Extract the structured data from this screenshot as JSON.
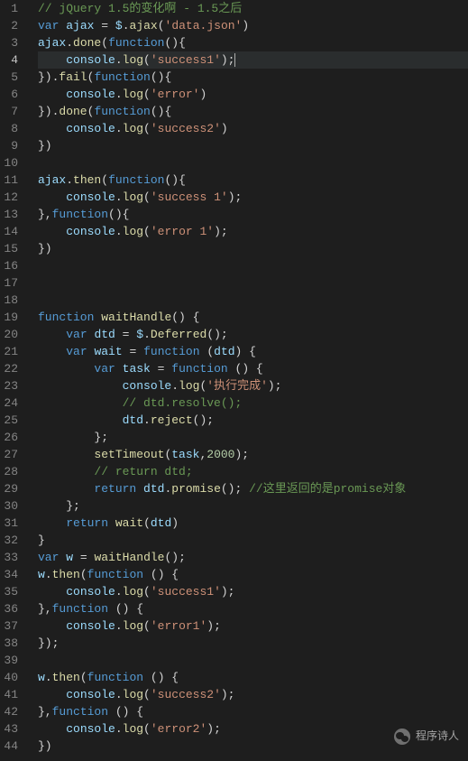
{
  "editor": {
    "activeLine": 4,
    "lines": [
      {
        "n": 1,
        "tokens": [
          [
            "c-comment",
            "// jQuery 1.5的变化啊 - 1.5之后"
          ]
        ]
      },
      {
        "n": 2,
        "tokens": [
          [
            "c-kw",
            "var"
          ],
          [
            "",
            " "
          ],
          [
            "c-var",
            "ajax"
          ],
          [
            "",
            " "
          ],
          [
            "c-punc",
            "="
          ],
          [
            "",
            " "
          ],
          [
            "c-var",
            "$"
          ],
          [
            "c-punc",
            "."
          ],
          [
            "c-func",
            "ajax"
          ],
          [
            "c-punc",
            "("
          ],
          [
            "c-str",
            "'data.json'"
          ],
          [
            "c-punc",
            ")"
          ]
        ]
      },
      {
        "n": 3,
        "tokens": [
          [
            "c-var",
            "ajax"
          ],
          [
            "c-punc",
            "."
          ],
          [
            "c-func",
            "done"
          ],
          [
            "c-punc",
            "("
          ],
          [
            "c-kw",
            "function"
          ],
          [
            "c-punc",
            "(){"
          ]
        ]
      },
      {
        "n": 4,
        "hl": true,
        "tokens": [
          [
            "",
            "    "
          ],
          [
            "c-var",
            "console"
          ],
          [
            "c-punc",
            "."
          ],
          [
            "c-func",
            "log"
          ],
          [
            "c-punc",
            "("
          ],
          [
            "c-str",
            "'success1'"
          ],
          [
            "c-punc",
            ");"
          ],
          [
            "cursor",
            ""
          ]
        ]
      },
      {
        "n": 5,
        "tokens": [
          [
            "c-punc",
            "})."
          ],
          [
            "c-func",
            "fail"
          ],
          [
            "c-punc",
            "("
          ],
          [
            "c-kw",
            "function"
          ],
          [
            "c-punc",
            "(){"
          ]
        ]
      },
      {
        "n": 6,
        "tokens": [
          [
            "",
            "    "
          ],
          [
            "c-var",
            "console"
          ],
          [
            "c-punc",
            "."
          ],
          [
            "c-func",
            "log"
          ],
          [
            "c-punc",
            "("
          ],
          [
            "c-str",
            "'error'"
          ],
          [
            "c-punc",
            ")"
          ]
        ]
      },
      {
        "n": 7,
        "tokens": [
          [
            "c-punc",
            "})."
          ],
          [
            "c-func",
            "done"
          ],
          [
            "c-punc",
            "("
          ],
          [
            "c-kw",
            "function"
          ],
          [
            "c-punc",
            "(){"
          ]
        ]
      },
      {
        "n": 8,
        "tokens": [
          [
            "",
            "    "
          ],
          [
            "c-var",
            "console"
          ],
          [
            "c-punc",
            "."
          ],
          [
            "c-func",
            "log"
          ],
          [
            "c-punc",
            "("
          ],
          [
            "c-str",
            "'success2'"
          ],
          [
            "c-punc",
            ")"
          ]
        ]
      },
      {
        "n": 9,
        "tokens": [
          [
            "c-punc",
            "})"
          ]
        ]
      },
      {
        "n": 10,
        "tokens": []
      },
      {
        "n": 11,
        "tokens": [
          [
            "c-var",
            "ajax"
          ],
          [
            "c-punc",
            "."
          ],
          [
            "c-func",
            "then"
          ],
          [
            "c-punc",
            "("
          ],
          [
            "c-kw",
            "function"
          ],
          [
            "c-punc",
            "(){"
          ]
        ]
      },
      {
        "n": 12,
        "tokens": [
          [
            "",
            "    "
          ],
          [
            "c-var",
            "console"
          ],
          [
            "c-punc",
            "."
          ],
          [
            "c-func",
            "log"
          ],
          [
            "c-punc",
            "("
          ],
          [
            "c-str",
            "'success 1'"
          ],
          [
            "c-punc",
            ");"
          ]
        ]
      },
      {
        "n": 13,
        "tokens": [
          [
            "c-punc",
            "},"
          ],
          [
            "c-kw",
            "function"
          ],
          [
            "c-punc",
            "(){"
          ]
        ]
      },
      {
        "n": 14,
        "tokens": [
          [
            "",
            "    "
          ],
          [
            "c-var",
            "console"
          ],
          [
            "c-punc",
            "."
          ],
          [
            "c-func",
            "log"
          ],
          [
            "c-punc",
            "("
          ],
          [
            "c-str",
            "'error 1'"
          ],
          [
            "c-punc",
            ");"
          ]
        ]
      },
      {
        "n": 15,
        "tokens": [
          [
            "c-punc",
            "})"
          ]
        ]
      },
      {
        "n": 16,
        "tokens": []
      },
      {
        "n": 17,
        "tokens": []
      },
      {
        "n": 18,
        "tokens": []
      },
      {
        "n": 19,
        "tokens": [
          [
            "c-kw",
            "function"
          ],
          [
            "",
            " "
          ],
          [
            "c-func",
            "waitHandle"
          ],
          [
            "c-punc",
            "() {"
          ]
        ]
      },
      {
        "n": 20,
        "tokens": [
          [
            "",
            "    "
          ],
          [
            "c-kw",
            "var"
          ],
          [
            "",
            " "
          ],
          [
            "c-var",
            "dtd"
          ],
          [
            "",
            " "
          ],
          [
            "c-punc",
            "="
          ],
          [
            "",
            " "
          ],
          [
            "c-var",
            "$"
          ],
          [
            "c-punc",
            "."
          ],
          [
            "c-func",
            "Deferred"
          ],
          [
            "c-punc",
            "();"
          ]
        ]
      },
      {
        "n": 21,
        "tokens": [
          [
            "",
            "    "
          ],
          [
            "c-kw",
            "var"
          ],
          [
            "",
            " "
          ],
          [
            "c-var",
            "wait"
          ],
          [
            "",
            " "
          ],
          [
            "c-punc",
            "="
          ],
          [
            "",
            " "
          ],
          [
            "c-kw",
            "function"
          ],
          [
            "",
            " "
          ],
          [
            "c-punc",
            "("
          ],
          [
            "c-var",
            "dtd"
          ],
          [
            "c-punc",
            ") {"
          ]
        ]
      },
      {
        "n": 22,
        "tokens": [
          [
            "",
            "        "
          ],
          [
            "c-kw",
            "var"
          ],
          [
            "",
            " "
          ],
          [
            "c-var",
            "task"
          ],
          [
            "",
            " "
          ],
          [
            "c-punc",
            "="
          ],
          [
            "",
            " "
          ],
          [
            "c-kw",
            "function"
          ],
          [
            "",
            " "
          ],
          [
            "c-punc",
            "() {"
          ]
        ]
      },
      {
        "n": 23,
        "tokens": [
          [
            "",
            "            "
          ],
          [
            "c-var",
            "console"
          ],
          [
            "c-punc",
            "."
          ],
          [
            "c-func",
            "log"
          ],
          [
            "c-punc",
            "("
          ],
          [
            "c-str",
            "'执行完成'"
          ],
          [
            "c-punc",
            ");"
          ]
        ]
      },
      {
        "n": 24,
        "tokens": [
          [
            "",
            "            "
          ],
          [
            "c-comment",
            "// dtd.resolve();"
          ]
        ]
      },
      {
        "n": 25,
        "tokens": [
          [
            "",
            "            "
          ],
          [
            "c-var",
            "dtd"
          ],
          [
            "c-punc",
            "."
          ],
          [
            "c-func",
            "reject"
          ],
          [
            "c-punc",
            "();"
          ]
        ]
      },
      {
        "n": 26,
        "tokens": [
          [
            "",
            "        "
          ],
          [
            "c-punc",
            "};"
          ]
        ]
      },
      {
        "n": 27,
        "tokens": [
          [
            "",
            "        "
          ],
          [
            "c-func",
            "setTimeout"
          ],
          [
            "c-punc",
            "("
          ],
          [
            "c-var",
            "task"
          ],
          [
            "c-punc",
            ","
          ],
          [
            "c-num",
            "2000"
          ],
          [
            "c-punc",
            ");"
          ]
        ]
      },
      {
        "n": 28,
        "tokens": [
          [
            "",
            "        "
          ],
          [
            "c-comment",
            "// return dtd;"
          ]
        ]
      },
      {
        "n": 29,
        "tokens": [
          [
            "",
            "        "
          ],
          [
            "c-kw",
            "return"
          ],
          [
            "",
            " "
          ],
          [
            "c-var",
            "dtd"
          ],
          [
            "c-punc",
            "."
          ],
          [
            "c-func",
            "promise"
          ],
          [
            "c-punc",
            "(); "
          ],
          [
            "c-comment",
            "//这里返回的是promise对象"
          ]
        ]
      },
      {
        "n": 30,
        "tokens": [
          [
            "",
            "    "
          ],
          [
            "c-punc",
            "};"
          ]
        ]
      },
      {
        "n": 31,
        "tokens": [
          [
            "",
            "    "
          ],
          [
            "c-kw",
            "return"
          ],
          [
            "",
            " "
          ],
          [
            "c-func",
            "wait"
          ],
          [
            "c-punc",
            "("
          ],
          [
            "c-var",
            "dtd"
          ],
          [
            "c-punc",
            ")"
          ]
        ]
      },
      {
        "n": 32,
        "tokens": [
          [
            "c-punc",
            "}"
          ]
        ]
      },
      {
        "n": 33,
        "tokens": [
          [
            "c-kw",
            "var"
          ],
          [
            "",
            " "
          ],
          [
            "c-var",
            "w"
          ],
          [
            "",
            " "
          ],
          [
            "c-punc",
            "="
          ],
          [
            "",
            " "
          ],
          [
            "c-func",
            "waitHandle"
          ],
          [
            "c-punc",
            "();"
          ]
        ]
      },
      {
        "n": 34,
        "tokens": [
          [
            "c-var",
            "w"
          ],
          [
            "c-punc",
            "."
          ],
          [
            "c-func",
            "then"
          ],
          [
            "c-punc",
            "("
          ],
          [
            "c-kw",
            "function"
          ],
          [
            "",
            " "
          ],
          [
            "c-punc",
            "() {"
          ]
        ]
      },
      {
        "n": 35,
        "tokens": [
          [
            "",
            "    "
          ],
          [
            "c-var",
            "console"
          ],
          [
            "c-punc",
            "."
          ],
          [
            "c-func",
            "log"
          ],
          [
            "c-punc",
            "("
          ],
          [
            "c-str",
            "'success1'"
          ],
          [
            "c-punc",
            ");"
          ]
        ]
      },
      {
        "n": 36,
        "tokens": [
          [
            "c-punc",
            "},"
          ],
          [
            "c-kw",
            "function"
          ],
          [
            "",
            " "
          ],
          [
            "c-punc",
            "() {"
          ]
        ]
      },
      {
        "n": 37,
        "tokens": [
          [
            "",
            "    "
          ],
          [
            "c-var",
            "console"
          ],
          [
            "c-punc",
            "."
          ],
          [
            "c-func",
            "log"
          ],
          [
            "c-punc",
            "("
          ],
          [
            "c-str",
            "'error1'"
          ],
          [
            "c-punc",
            ");"
          ]
        ]
      },
      {
        "n": 38,
        "tokens": [
          [
            "c-punc",
            "});"
          ]
        ]
      },
      {
        "n": 39,
        "tokens": []
      },
      {
        "n": 40,
        "tokens": [
          [
            "c-var",
            "w"
          ],
          [
            "c-punc",
            "."
          ],
          [
            "c-func",
            "then"
          ],
          [
            "c-punc",
            "("
          ],
          [
            "c-kw",
            "function"
          ],
          [
            "",
            " "
          ],
          [
            "c-punc",
            "() {"
          ]
        ]
      },
      {
        "n": 41,
        "tokens": [
          [
            "",
            "    "
          ],
          [
            "c-var",
            "console"
          ],
          [
            "c-punc",
            "."
          ],
          [
            "c-func",
            "log"
          ],
          [
            "c-punc",
            "("
          ],
          [
            "c-str",
            "'success2'"
          ],
          [
            "c-punc",
            ");"
          ]
        ]
      },
      {
        "n": 42,
        "tokens": [
          [
            "c-punc",
            "},"
          ],
          [
            "c-kw",
            "function"
          ],
          [
            "",
            " "
          ],
          [
            "c-punc",
            "() {"
          ]
        ]
      },
      {
        "n": 43,
        "tokens": [
          [
            "",
            "    "
          ],
          [
            "c-var",
            "console"
          ],
          [
            "c-punc",
            "."
          ],
          [
            "c-func",
            "log"
          ],
          [
            "c-punc",
            "("
          ],
          [
            "c-str",
            "'error2'"
          ],
          [
            "c-punc",
            ");"
          ]
        ]
      },
      {
        "n": 44,
        "tokens": [
          [
            "c-punc",
            "})"
          ]
        ]
      }
    ]
  },
  "watermark": {
    "label": "程序诗人"
  }
}
